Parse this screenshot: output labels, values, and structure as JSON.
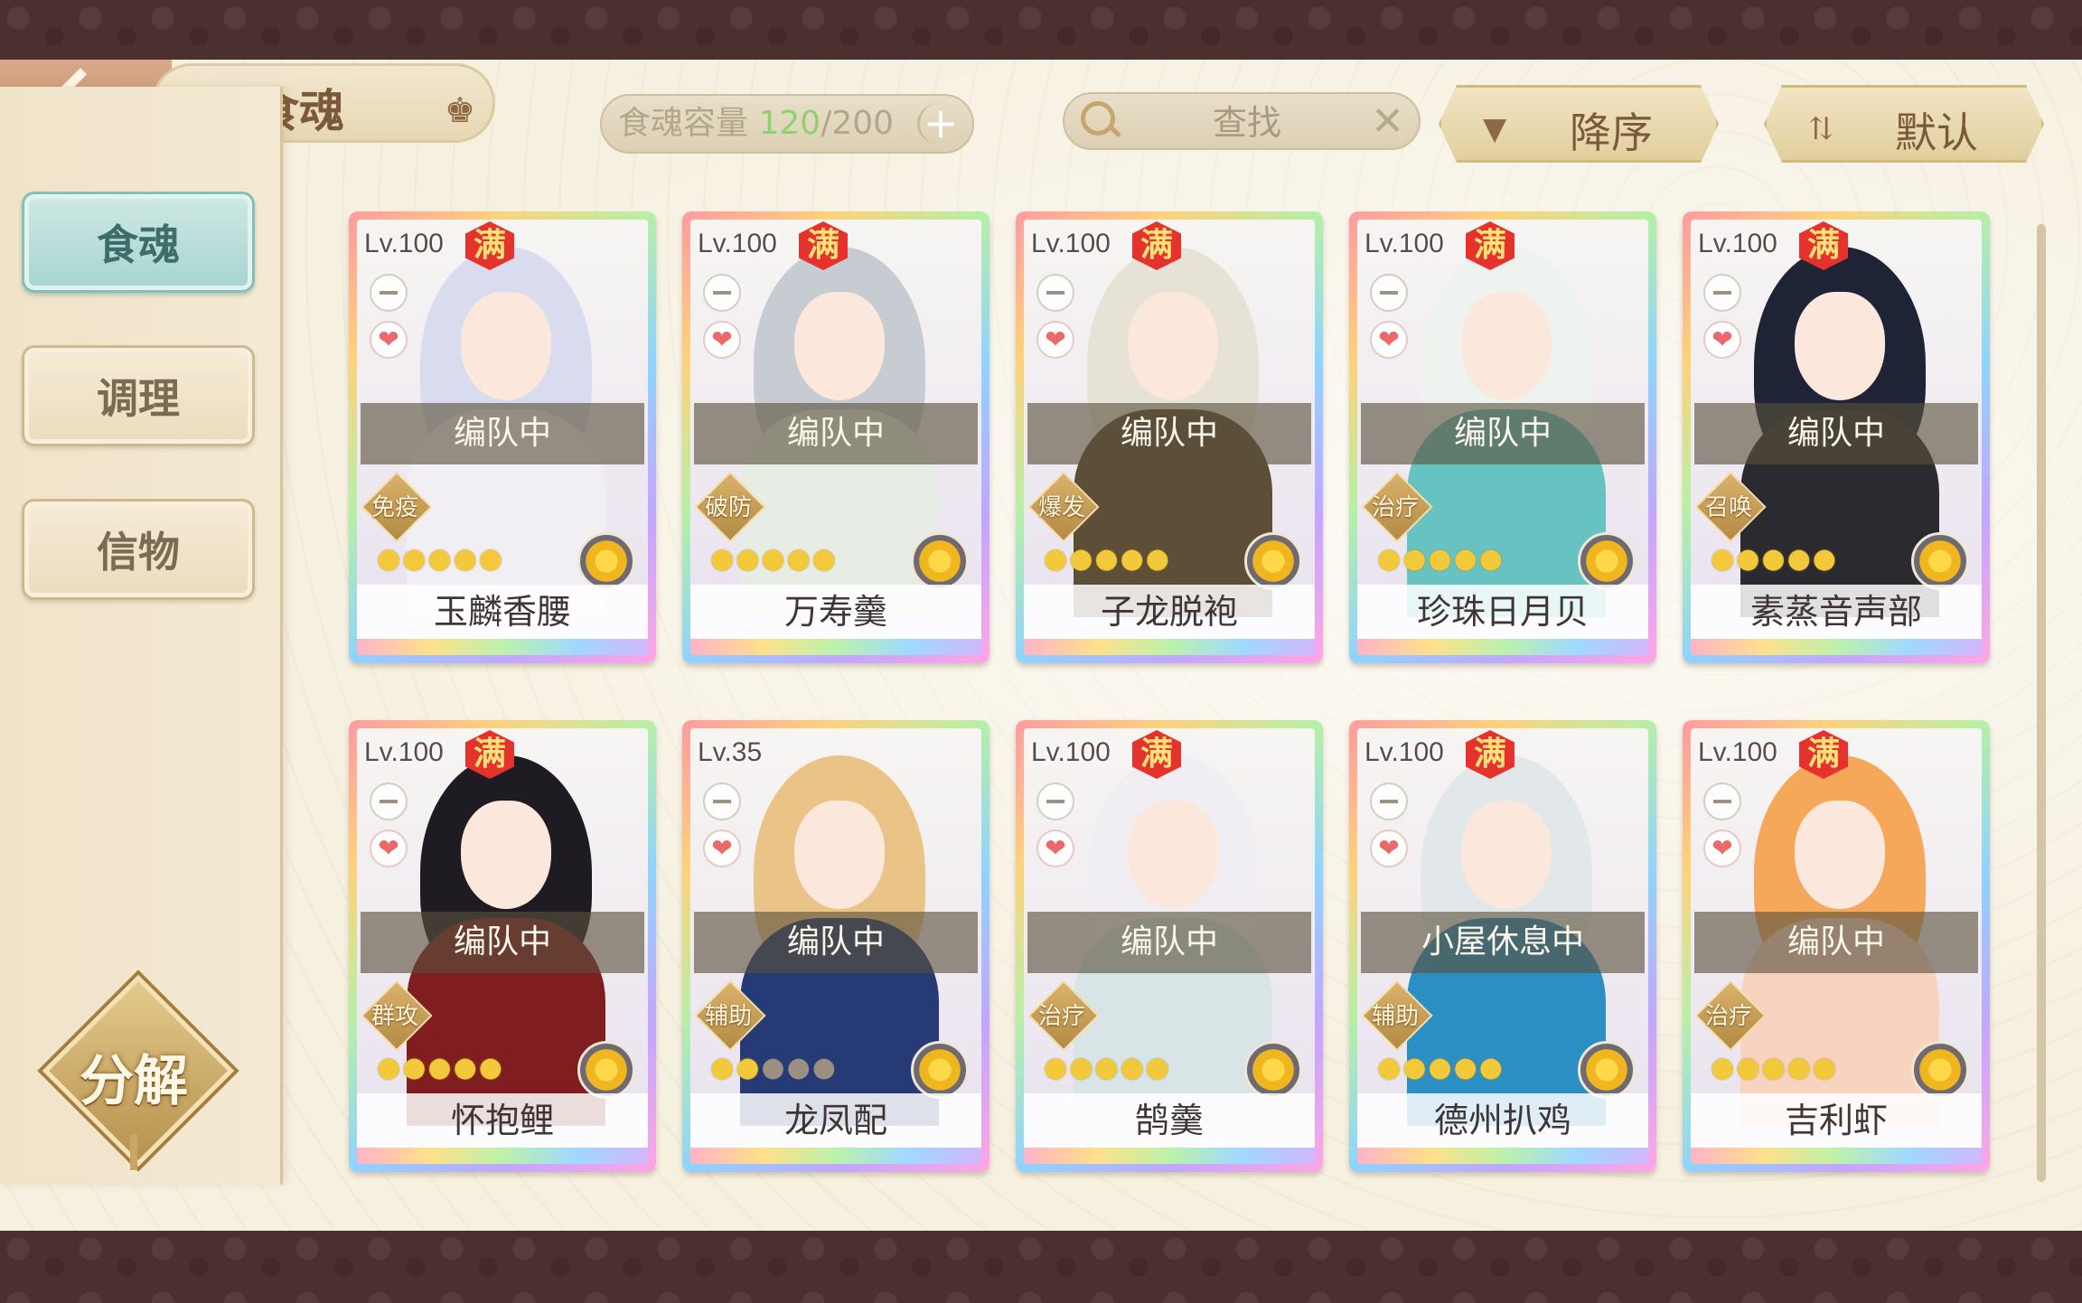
{
  "header": {
    "title": "食魂",
    "capacity_label": "食魂容量",
    "capacity_current": "120",
    "capacity_sep_total": "/200",
    "plus": "+",
    "search_placeholder": "查找",
    "clear": "✕",
    "sort_order_label": "降序",
    "sort_mode_label": "默认"
  },
  "sidebar": {
    "items": [
      {
        "label": "食魂",
        "active": true
      },
      {
        "label": "调理",
        "active": false
      },
      {
        "label": "信物",
        "active": false
      }
    ],
    "decompose_label": "分解"
  },
  "colors": {
    "accent": "#a7d4cf",
    "badge": "#e5322c",
    "star": "#f2c93a"
  },
  "cards": [
    {
      "level": "Lv.100",
      "max": "满",
      "status": "编队中",
      "role": "免疫",
      "name": "玉麟香腰",
      "stars_lit": 5,
      "hair": "#d9dbef",
      "robe": "#f1eef4"
    },
    {
      "level": "Lv.100",
      "max": "满",
      "status": "编队中",
      "role": "破防",
      "name": "万寿羹",
      "stars_lit": 5,
      "hair": "#c7ccd3",
      "robe": "#e7ede4"
    },
    {
      "level": "Lv.100",
      "max": "满",
      "status": "编队中",
      "role": "爆发",
      "name": "子龙脱袍",
      "stars_lit": 5,
      "hair": "#e7e2d6",
      "robe": "#5d4e38"
    },
    {
      "level": "Lv.100",
      "max": "满",
      "status": "编队中",
      "role": "治疗",
      "name": "珍珠日月贝",
      "stars_lit": 5,
      "hair": "#eef3f0",
      "robe": "#67c3c1"
    },
    {
      "level": "Lv.100",
      "max": "满",
      "status": "编队中",
      "role": "召唤",
      "name": "素蒸音声部",
      "stars_lit": 5,
      "hair": "#1f2336",
      "robe": "#2b2a31"
    },
    {
      "level": "Lv.100",
      "max": "满",
      "status": "编队中",
      "role": "群攻",
      "name": "怀抱鲤",
      "stars_lit": 5,
      "hair": "#1e1b22",
      "robe": "#7f1d20"
    },
    {
      "level": "Lv.35",
      "max": "",
      "status": "编队中",
      "role": "辅助",
      "name": "龙凤配",
      "stars_lit": 2,
      "hair": "#e9c486",
      "robe": "#263a75"
    },
    {
      "level": "Lv.100",
      "max": "满",
      "status": "编队中",
      "role": "治疗",
      "name": "鹄羹",
      "stars_lit": 5,
      "hair": "#f0eef3",
      "robe": "#d8e4e6"
    },
    {
      "level": "Lv.100",
      "max": "满",
      "status": "小屋休息中",
      "role": "辅助",
      "name": "德州扒鸡",
      "stars_lit": 5,
      "hair": "#e2e7ea",
      "robe": "#2c8fc4"
    },
    {
      "level": "Lv.100",
      "max": "满",
      "status": "编队中",
      "role": "治疗",
      "name": "吉利虾",
      "stars_lit": 5,
      "hair": "#f5a85a",
      "robe": "#f7d3c0"
    }
  ]
}
